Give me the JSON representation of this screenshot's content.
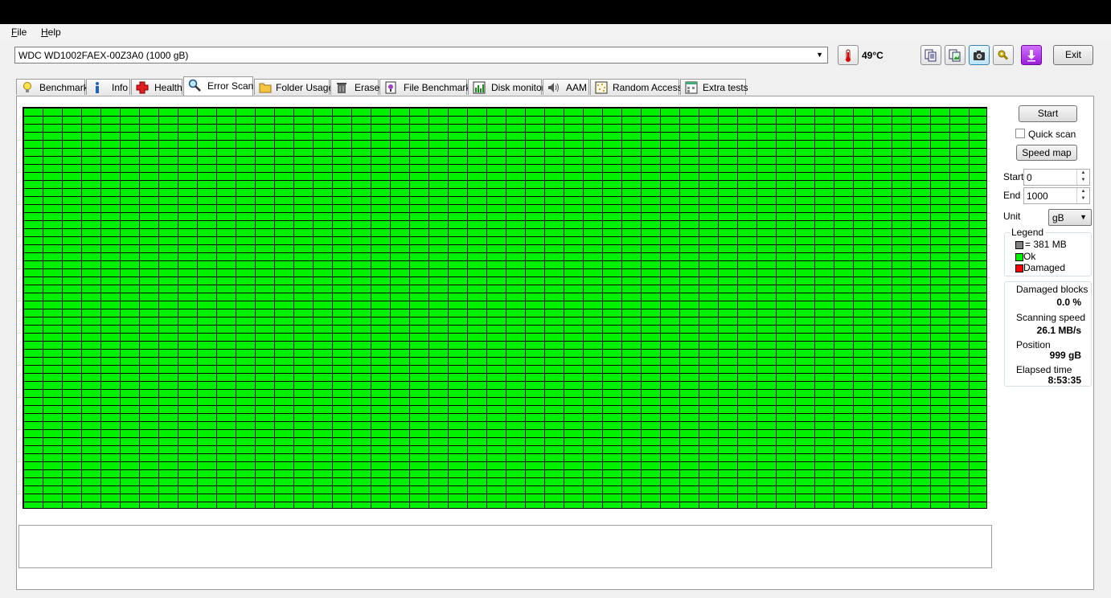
{
  "menu": {
    "file": "File",
    "help": "Help"
  },
  "drive": {
    "selected": "WDC WD1002FAEX-00Z3A0 (1000 gB)"
  },
  "temperature": "49°C",
  "toolbar": {
    "exit_label": "Exit"
  },
  "tabs": [
    {
      "label": "Benchmark",
      "icon": "benchmark-icon"
    },
    {
      "label": "Info",
      "icon": "info-icon"
    },
    {
      "label": "Health",
      "icon": "health-cross-icon"
    },
    {
      "label": "Error Scan",
      "icon": "magnifier-icon",
      "active": true
    },
    {
      "label": "Folder Usage",
      "icon": "folder-icon"
    },
    {
      "label": "Erase",
      "icon": "trash-icon"
    },
    {
      "label": "File Benchmark",
      "icon": "file-benchmark-icon"
    },
    {
      "label": "Disk monitor",
      "icon": "disk-monitor-icon"
    },
    {
      "label": "AAM",
      "icon": "speaker-icon"
    },
    {
      "label": "Random Access",
      "icon": "random-access-icon"
    },
    {
      "label": "Extra tests",
      "icon": "extra-tests-icon"
    }
  ],
  "scan": {
    "start_button": "Start",
    "quick_scan_label": "Quick scan",
    "quick_scan_checked": false,
    "speed_map_button": "Speed map",
    "start_label": "Start",
    "start_value": "0",
    "end_label": "End",
    "end_value": "1000",
    "unit_label": "Unit",
    "unit_value": "gB"
  },
  "legend": {
    "title": "Legend",
    "block_size": "= 381 MB",
    "ok": "Ok",
    "damaged": "Damaged",
    "colors": {
      "block": "#808080",
      "ok": "#00f000",
      "damaged": "#ff0000"
    }
  },
  "stats": {
    "damaged_blocks_label": "Damaged blocks",
    "damaged_blocks_value": "0.0 %",
    "scanning_speed_label": "Scanning speed",
    "scanning_speed_value": "26.1 MB/s",
    "position_label": "Position",
    "position_value": "999 gB",
    "elapsed_label": "Elapsed time",
    "elapsed_value": "8:53:35"
  },
  "grid": {
    "status": "all blocks ok",
    "color": "#00f000"
  }
}
